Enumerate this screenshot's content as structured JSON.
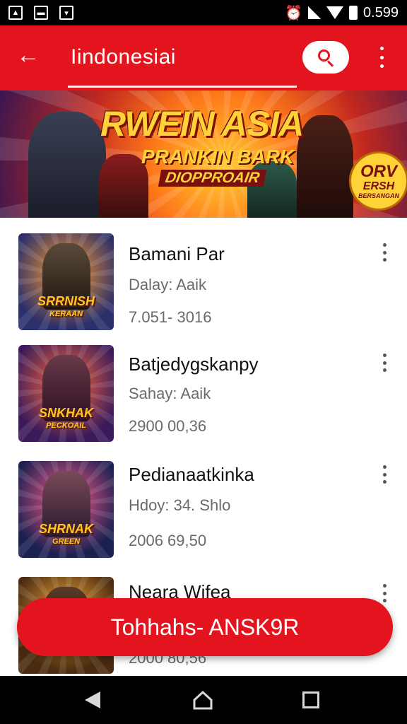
{
  "status_bar": {
    "time": "0.599",
    "icons": [
      "image-icon",
      "image-icon",
      "download-icon"
    ],
    "right_icons": [
      "alarm-icon",
      "signal-icon",
      "wifi-icon",
      "battery-icon"
    ]
  },
  "app_bar": {
    "title": "Iindonesiai",
    "back_icon": "back-arrow-icon",
    "search_icon": "search-icon",
    "overflow_icon": "more-vert-icon"
  },
  "banner": {
    "title": "RWEIN ASIA",
    "subtitle": "PRANKIN BARK",
    "tagline": "DIOPPROAIR",
    "badge": [
      "ORV",
      "ERSH",
      "BERSANGAN"
    ]
  },
  "items": [
    {
      "title": "Bamani Par",
      "subtitle": "Dalay: Aaik",
      "meta": "7.051- 3016",
      "thumb_logo": [
        "SRRNISH",
        "KERAAN"
      ]
    },
    {
      "title": "Batjedygskanpy",
      "subtitle": "Sahay: Aaik",
      "meta": "2900 00,36",
      "thumb_logo": [
        "SNKHAK",
        "PECKOAIL"
      ]
    },
    {
      "title": "Pedianaatkinka",
      "subtitle": "Hdoy: 34. Shlo",
      "meta": "2006 69,50",
      "thumb_logo": [
        "SHRNAK",
        "GREEN"
      ]
    },
    {
      "title": "Neara Wifea",
      "subtitle": "",
      "meta": "2000 80,56",
      "thumb_logo": [
        "",
        ""
      ]
    }
  ],
  "fab": {
    "label": "Tohhahs- ANSK9R"
  },
  "nav_bar": {
    "icons": [
      "nav-back-icon",
      "nav-home-icon",
      "nav-recents-icon"
    ]
  },
  "colors": {
    "accent": "#e3141e",
    "title": "#111111",
    "secondary_text": "#6a6a6a"
  }
}
